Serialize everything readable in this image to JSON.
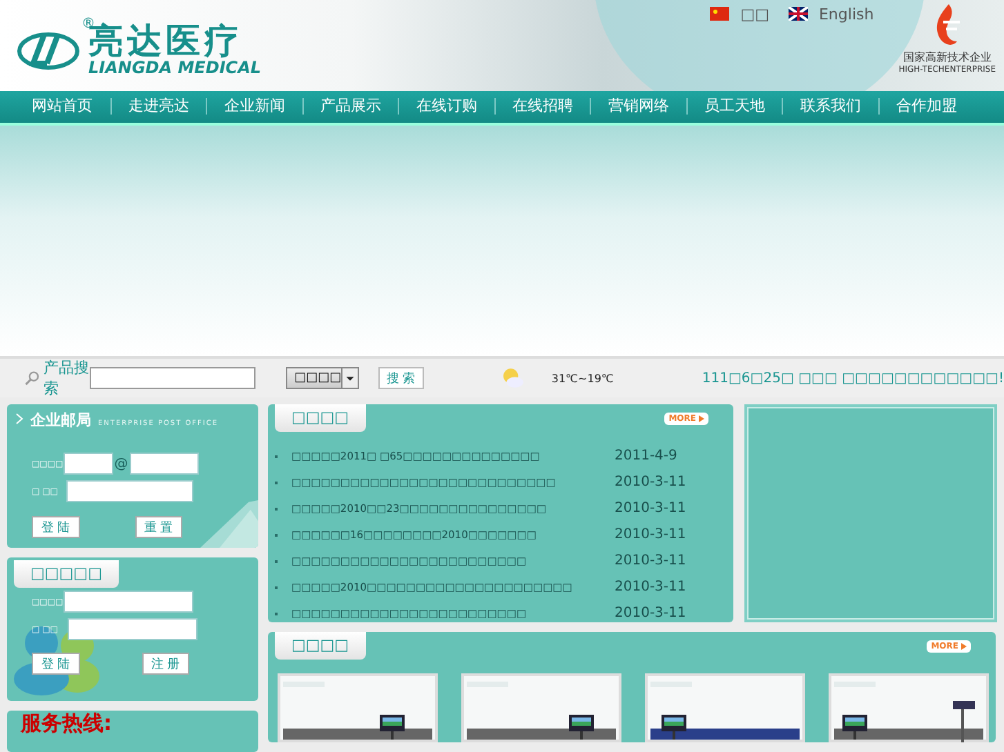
{
  "header": {
    "logo_cn": "亮达医疗",
    "logo_en": "LIANGDA MEDICAL",
    "registered": "®",
    "languages": [
      {
        "kind": "cn",
        "label": "□□"
      },
      {
        "kind": "en",
        "label": "English"
      }
    ],
    "badge_cn": "国家高新技术企业",
    "badge_en": "HIGH-TECHENTERPRISE"
  },
  "nav": [
    "网站首页",
    "走进亮达",
    "企业新闻",
    "产品展示",
    "在线订购",
    "在线招聘",
    "营销网络",
    "员工天地",
    "联系我们",
    "合作加盟"
  ],
  "search": {
    "label": "产品搜索",
    "category": "□□□□",
    "button": "搜 索",
    "weather": "31℃~19℃",
    "notice": "111□6□25□ □□□ □□□□□□□□□□□□!"
  },
  "mail": {
    "title": "企业邮局",
    "subtitle": "ENTERPRISE POST OFFICE",
    "user_label": "□□□□",
    "at": "@",
    "password_label": "□ □□",
    "buttons": [
      "登 陆",
      "重 置"
    ]
  },
  "member": {
    "title": "□□□□□",
    "user_label": "□□□□",
    "password_label": "□ □□",
    "buttons": [
      "登 陆",
      "注 册"
    ]
  },
  "hotline": {
    "title": "服务热线:"
  },
  "news": {
    "title": "□□□□",
    "more": "MORE",
    "items": [
      {
        "title": "□□□□□2011□ □65□□□□□□□□□□□□□□",
        "date": "2011-4-9"
      },
      {
        "title": "□□□□□□□□□□□□□□□□□□□□□□□□□□□",
        "date": "2010-3-11"
      },
      {
        "title": "□□□□□2010□□23□□□□□□□□□□□□□□□",
        "date": "2010-3-11"
      },
      {
        "title": "□□□□□□16□□□□□□□□2010□□□□□□□",
        "date": "2010-3-11"
      },
      {
        "title": "□□□□□□□□□□□□□□□□□□□□□□□□",
        "date": "2010-3-11"
      },
      {
        "title": "□□□□□2010□□□□□□□□□□□□□□□□□□□□□",
        "date": "2010-3-11"
      },
      {
        "title": "□□□□□□□□□□□□□□□□□□□□□□□□",
        "date": "2010-3-11"
      }
    ]
  },
  "products": {
    "title": "□□□□",
    "more": "MORE"
  }
}
